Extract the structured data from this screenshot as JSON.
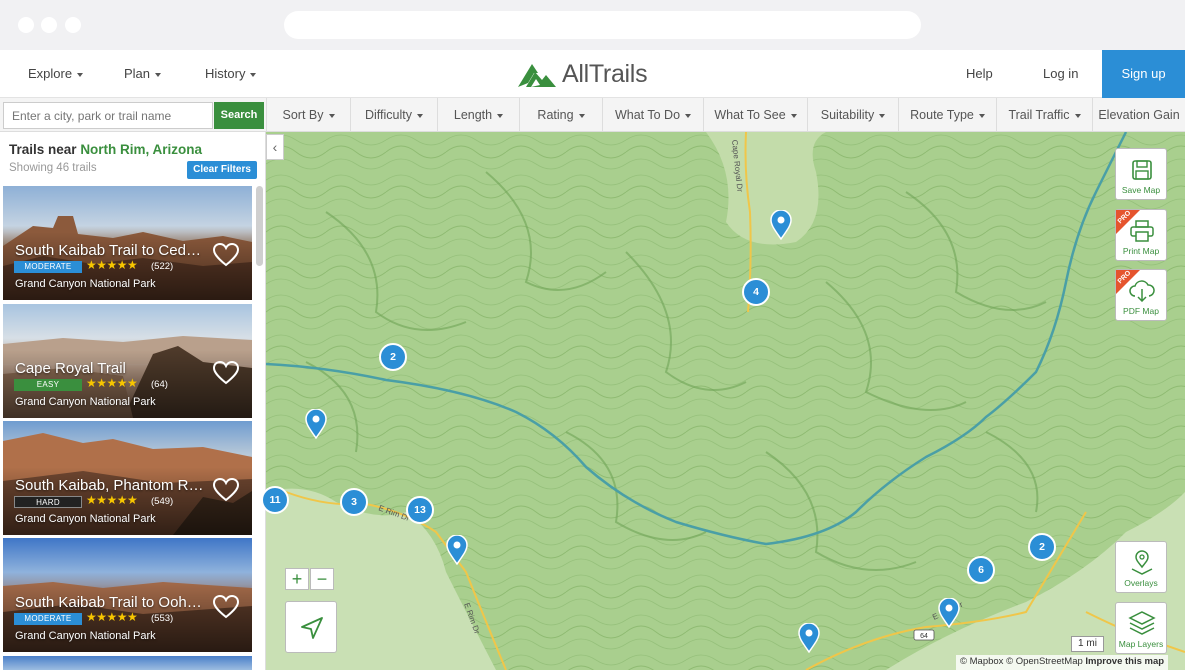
{
  "nav": {
    "explore": "Explore",
    "plan": "Plan",
    "history": "History",
    "logo": "AllTrails",
    "help": "Help",
    "login": "Log in",
    "signup": "Sign up"
  },
  "search": {
    "placeholder": "Enter a city, park or trail name",
    "button": "Search"
  },
  "filters": [
    "Sort By",
    "Difficulty",
    "Length",
    "Rating",
    "What To Do",
    "What To See",
    "Suitability",
    "Route Type",
    "Trail Traffic",
    "Elevation Gain"
  ],
  "sidebar": {
    "title_prefix": "Trails near",
    "location": "North Rim, Arizona",
    "count": "Showing 46 trails",
    "clear": "Clear Filters"
  },
  "trails": [
    {
      "name": "South Kaibab Trail to Ced…",
      "difficulty": "MODERATE",
      "rating": 5,
      "reviews": "(522)",
      "park": "Grand Canyon National Park"
    },
    {
      "name": "Cape Royal Trail",
      "difficulty": "EASY",
      "rating": 5,
      "reviews": "(64)",
      "park": "Grand Canyon National Park"
    },
    {
      "name": "South Kaibab, Phantom R…",
      "difficulty": "HARD",
      "rating": 5,
      "reviews": "(549)",
      "park": "Grand Canyon National Park"
    },
    {
      "name": "South Kaibab Trail to Ooh…",
      "difficulty": "MODERATE",
      "rating": 5,
      "reviews": "(553)",
      "park": "Grand Canyon National Park"
    }
  ],
  "stars_text": "★★★★★",
  "map": {
    "save": "Save Map",
    "print": "Print Map",
    "pdf": "PDF Map",
    "pro": "PRO",
    "overlays": "Overlays",
    "layers": "Map Layers",
    "zoom_in": "+",
    "zoom_out": "−",
    "scale": "1 mi",
    "attribution": "© Mapbox © OpenStreetMap",
    "improve": "Improve this map",
    "road_shield": "64",
    "clusters": [
      "2",
      "4",
      "11",
      "3",
      "13",
      "6",
      "2"
    ],
    "road_labels": [
      "Cape Royal Dr",
      "E Rim Dr",
      "E Rim Dr",
      "E Rim Dr"
    ]
  },
  "colors": {
    "accent_green": "#3a8f3e",
    "primary_blue": "#2b8ed6",
    "moderate": "#2b8ed6",
    "easy": "#3a8f3e",
    "hard": "#222222",
    "map_bg": "#a9cf8e",
    "river": "#4a9fa6",
    "road": "#f0c649"
  }
}
